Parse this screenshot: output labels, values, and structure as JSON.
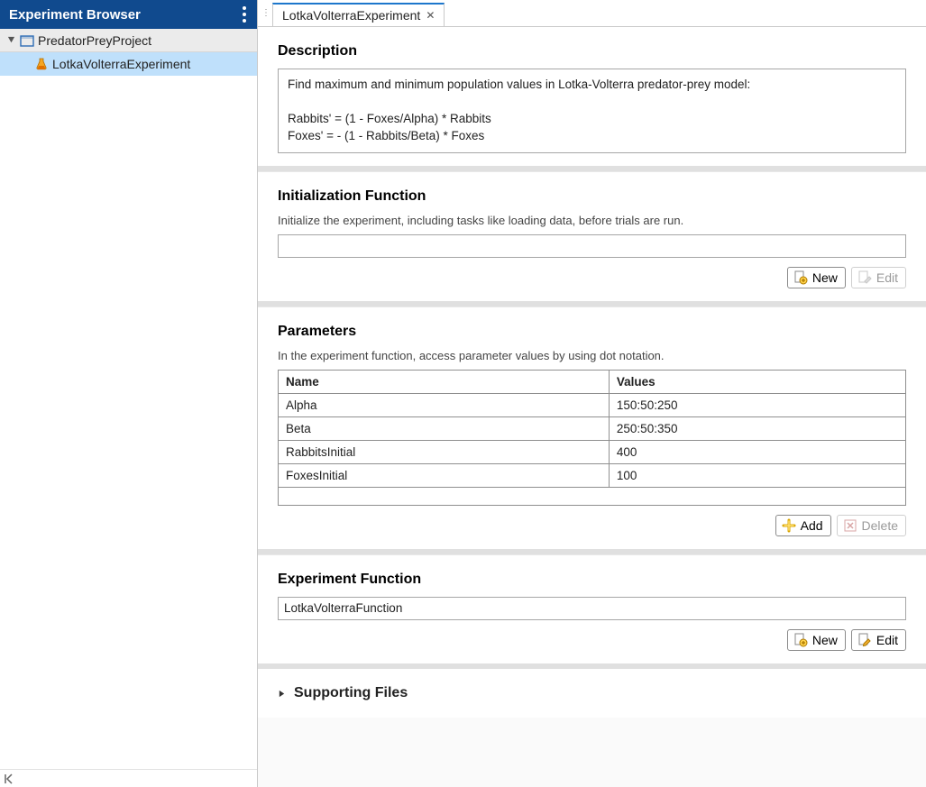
{
  "sidebar": {
    "title": "Experiment Browser",
    "root": {
      "label": "PredatorPreyProject"
    },
    "items": [
      {
        "label": "LotkaVolterraExperiment",
        "selected": true
      }
    ]
  },
  "tabs": [
    {
      "label": "LotkaVolterraExperiment",
      "active": true
    }
  ],
  "description": {
    "heading": "Description",
    "text": "Find maximum and minimum population values in Lotka-Volterra predator-prey model:\n\nRabbits' = (1 - Foxes/Alpha) * Rabbits\nFoxes' = - (1 - Rabbits/Beta) * Foxes"
  },
  "init": {
    "heading": "Initialization Function",
    "subtext": "Initialize the experiment, including tasks like loading data, before trials are run.",
    "value": "",
    "buttons": {
      "new": "New",
      "edit": "Edit"
    }
  },
  "parameters": {
    "heading": "Parameters",
    "subtext": "In the experiment function, access parameter values by using dot notation.",
    "columns": [
      "Name",
      "Values"
    ],
    "rows": [
      {
        "name": "Alpha",
        "values": "150:50:250"
      },
      {
        "name": "Beta",
        "values": "250:50:350"
      },
      {
        "name": "RabbitsInitial",
        "values": "400"
      },
      {
        "name": "FoxesInitial",
        "values": "100"
      }
    ],
    "buttons": {
      "add": "Add",
      "delete": "Delete"
    }
  },
  "experiment_function": {
    "heading": "Experiment Function",
    "value": "LotkaVolterraFunction",
    "buttons": {
      "new": "New",
      "edit": "Edit"
    }
  },
  "supporting": {
    "heading": "Supporting Files"
  }
}
